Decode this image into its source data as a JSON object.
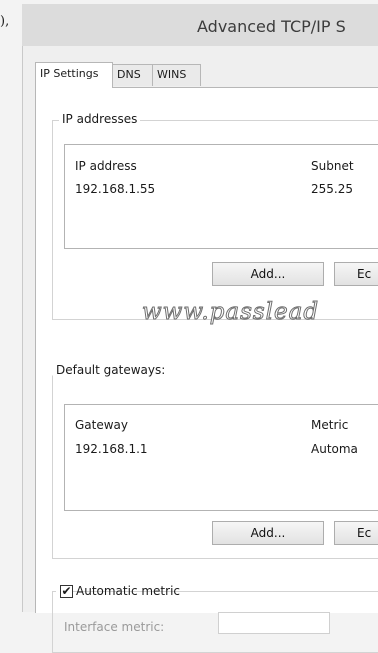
{
  "prefix": "),",
  "window": {
    "title": "Advanced TCP/IP S"
  },
  "tabs": [
    {
      "label": "IP Settings",
      "active": true
    },
    {
      "label": "DNS",
      "active": false
    },
    {
      "label": "WINS",
      "active": false
    }
  ],
  "ip_addresses": {
    "group_label": "IP addresses",
    "columns": [
      "IP address",
      "Subnet"
    ],
    "rows": [
      {
        "ip": "192.168.1.55",
        "subnet": "255.25"
      }
    ],
    "add_label": "Add...",
    "edit_label": "Ec"
  },
  "watermark": "www.passlead",
  "gateways": {
    "group_label": "Default gateways:",
    "columns": [
      "Gateway",
      "Metric"
    ],
    "rows": [
      {
        "gateway": "192.168.1.1",
        "metric": "Automa"
      }
    ],
    "add_label": "Add...",
    "edit_label": "Ec"
  },
  "automatic_metric": {
    "label": "Automatic metric",
    "checked": true,
    "check_glyph": "✔",
    "interface_metric_label": "Interface metric:",
    "interface_metric_value": ""
  }
}
